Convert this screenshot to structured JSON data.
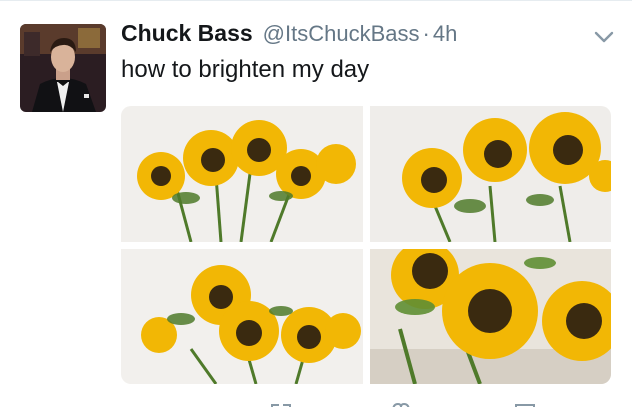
{
  "tweet": {
    "display_name": "Chuck Bass",
    "handle": "@ItsChuckBass",
    "separator": "·",
    "timestamp": "4h",
    "text": "how to brighten my day",
    "media_count": 4
  },
  "icons": {
    "menu": "chevron-down-icon",
    "actions": [
      "retweet-icon",
      "like-icon",
      "message-icon"
    ]
  },
  "colors": {
    "text_primary": "#14171a",
    "text_secondary": "#657786",
    "divider": "#e6ecf0",
    "sunflower_petal": "#f2b705",
    "sunflower_center": "#3a2a10",
    "stem": "#4f7a2a"
  }
}
